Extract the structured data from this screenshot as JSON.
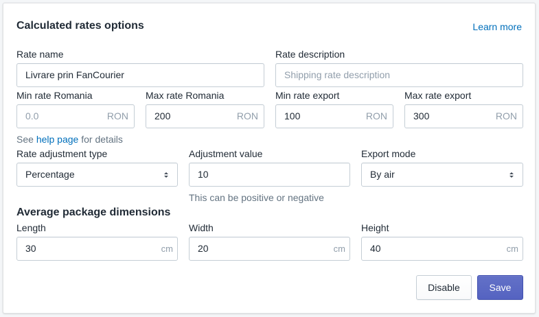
{
  "card": {
    "title": "Calculated rates options",
    "learn_more": "Learn more"
  },
  "rate_name": {
    "label": "Rate name",
    "value": "Livrare prin FanCourier"
  },
  "rate_description": {
    "label": "Rate description",
    "placeholder": "Shipping rate description",
    "value": ""
  },
  "min_rate_romania": {
    "label": "Min rate Romania",
    "placeholder": "0.0",
    "value": "",
    "suffix": "RON"
  },
  "max_rate_romania": {
    "label": "Max rate Romania",
    "value": "200",
    "suffix": "RON"
  },
  "min_rate_export": {
    "label": "Min rate export",
    "value": "100",
    "suffix": "RON"
  },
  "max_rate_export": {
    "label": "Max rate export",
    "value": "300",
    "suffix": "RON"
  },
  "help": {
    "prefix": "See ",
    "link": "help page",
    "suffix": " for details"
  },
  "rate_adjustment_type": {
    "label": "Rate adjustment type",
    "selected": "Percentage"
  },
  "adjustment_value": {
    "label": "Adjustment value",
    "value": "10",
    "help": "This can be positive or negative"
  },
  "export_mode": {
    "label": "Export mode",
    "selected": "By air"
  },
  "dimensions": {
    "title": "Average package dimensions",
    "length": {
      "label": "Length",
      "value": "30",
      "suffix": "cm"
    },
    "width": {
      "label": "Width",
      "value": "20",
      "suffix": "cm"
    },
    "height": {
      "label": "Height",
      "value": "40",
      "suffix": "cm"
    }
  },
  "actions": {
    "disable": "Disable",
    "save": "Save"
  },
  "colors": {
    "primary": "#5c6ac4",
    "link": "#006fbb",
    "border": "#c4cdd5",
    "muted": "#919eab"
  },
  "icons": {
    "select": "select-arrows-icon"
  }
}
